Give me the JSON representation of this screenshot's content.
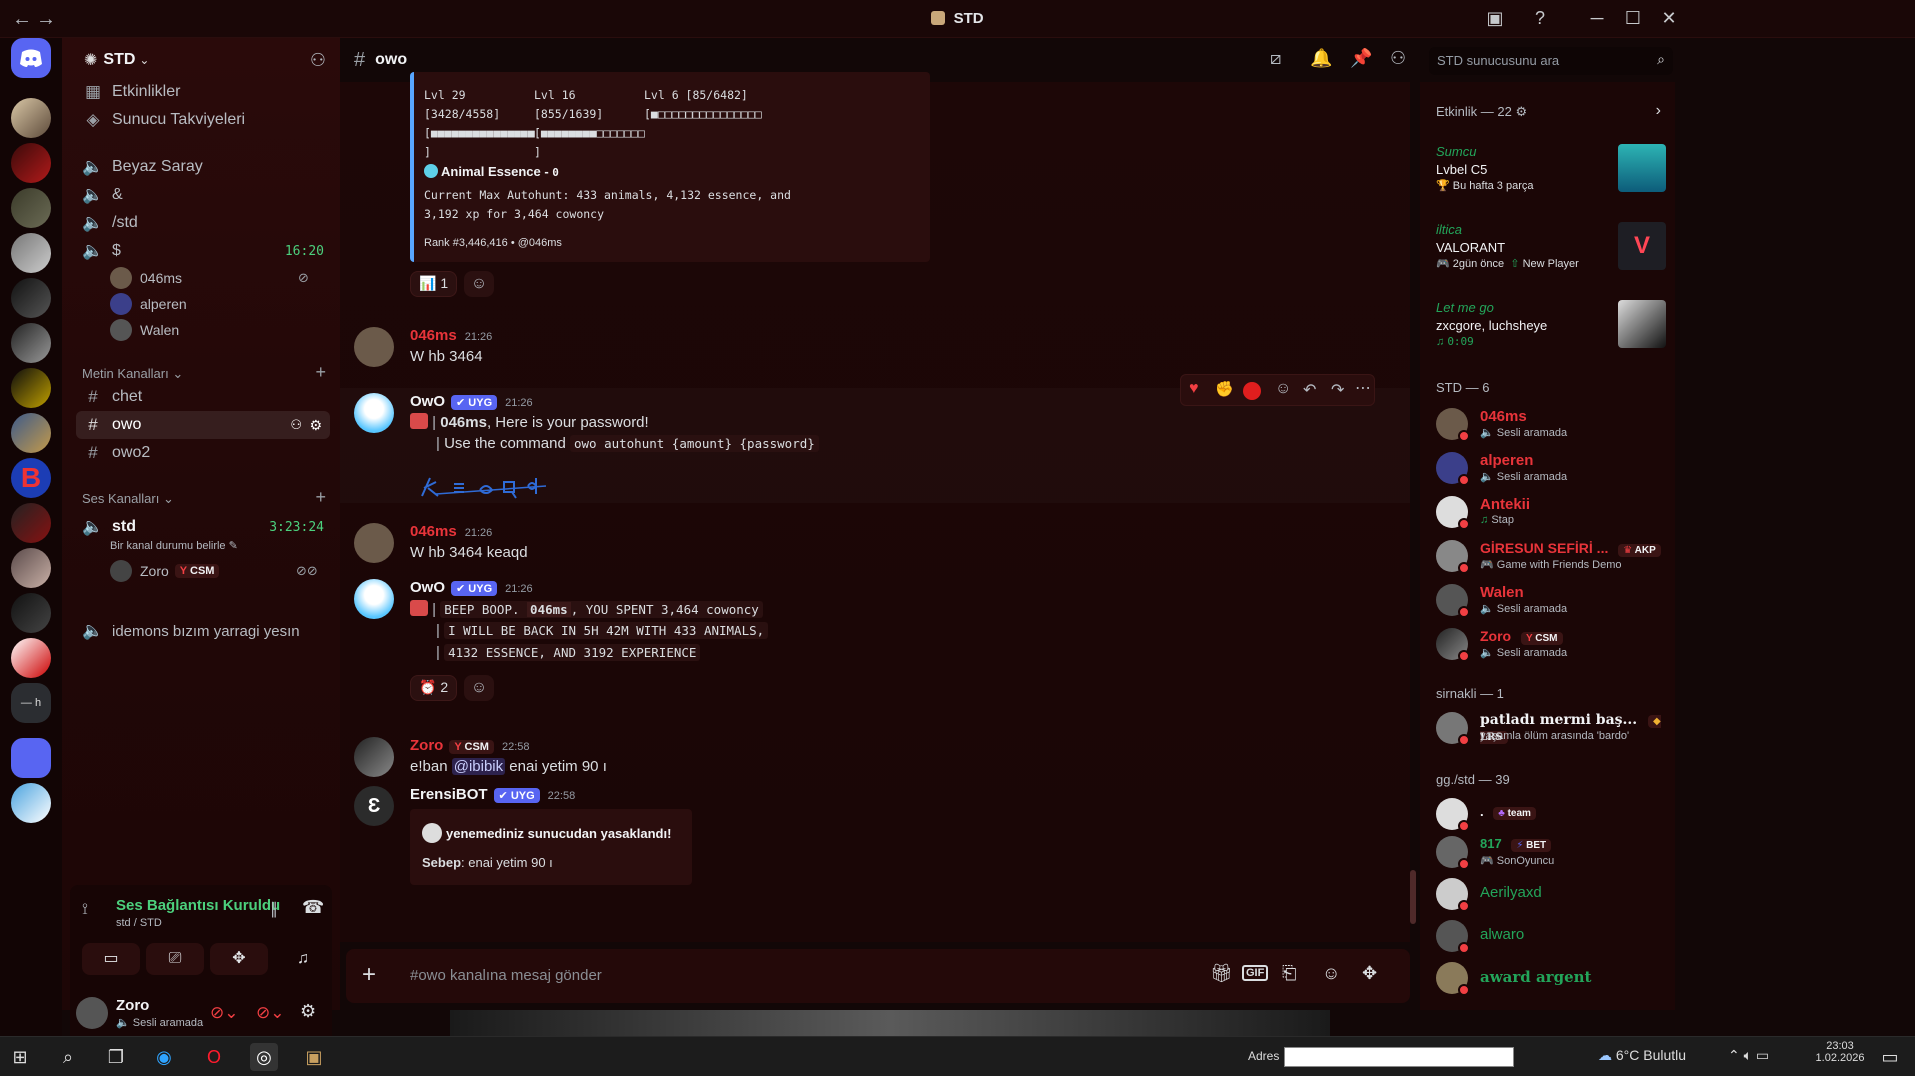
{
  "window": {
    "title": "STD"
  },
  "server": {
    "name": "STD",
    "events": "Etkinlikler",
    "boosts": "Sunucu Takviyeleri",
    "channels_top": [
      {
        "name": "Beyaz Saray"
      },
      {
        "name": "&"
      },
      {
        "name": "/std"
      },
      {
        "name": "$",
        "time": "16:20"
      }
    ],
    "voice_users_top": [
      {
        "name": "046ms"
      },
      {
        "name": "alperen"
      },
      {
        "name": "Walen"
      }
    ],
    "text_category": "Metin Kanalları",
    "text_channels": [
      {
        "name": "chet"
      },
      {
        "name": "owo"
      },
      {
        "name": "owo2"
      }
    ],
    "voice_category": "Ses Kanalları",
    "voice_channel": {
      "name": "std",
      "time": "3:23:24",
      "status": "Bir kanal durumu belirle"
    },
    "voice_channel_user": {
      "name": "Zoro",
      "tag": "CSM"
    },
    "voice_channel_2": "idemons bızım yarragi yesın"
  },
  "voice_panel": {
    "status": "Ses Bağlantısı Kuruldu",
    "sub": "std / STD",
    "user": "Zoro",
    "user_status": "Sesli aramada"
  },
  "channel": {
    "name": "owo",
    "search_placeholder": "STD sunucusunu ara",
    "composer_placeholder": "#owo kanalına mesaj gönder"
  },
  "embed_top": {
    "col1": [
      "Lvl 29",
      "[3428/4558]",
      "[■■■■■■■■■■■■■■■",
      "]"
    ],
    "col2": [
      "Lvl 16",
      "[855/1639]",
      "[■■■■■■■■□□□□□□□",
      "]"
    ],
    "col3": [
      "Lvl 6 [85/6482]",
      "[■□□□□□□□□□□□□□□□"
    ],
    "essence_title": "Animal Essence - ",
    "essence_value": "0",
    "autohunt_line1": "Current Max Autohunt: 433 animals, 4,132 essence, and",
    "autohunt_line2": "3,192 xp for 3,464 cowoncy",
    "rank": "Rank #3,446,416 • @046ms",
    "reaction_count": "1"
  },
  "messages": [
    {
      "author": "046ms",
      "time": "21:26",
      "text": "W hb 3464"
    },
    {
      "author": "OwO",
      "tag": "UYG",
      "time": "21:26",
      "mention": "046ms",
      "line1_rest": ", Here is your password!",
      "line2_prefix": "Use the command ",
      "line2_code": "owo autohunt {amount} {password}",
      "captcha": "keaqd"
    },
    {
      "author": "046ms",
      "time": "21:26",
      "text": "W hb 3464 keaqd"
    },
    {
      "author": "OwO",
      "tag": "UYG",
      "time": "21:26",
      "code1_a": "BEEP BOOP. ",
      "code1_b": "046ms",
      "code1_c": ", YOU SPENT 3,464 cowoncy",
      "code2": "I WILL BE BACK IN 5H 42M WITH 433 ANIMALS,",
      "code3": "4132 ESSENCE, AND 3192 EXPERIENCE",
      "reaction_count": "2"
    },
    {
      "author": "Zoro",
      "tag": "CSM",
      "time": "22:58",
      "prefix": "e!ban ",
      "mention": "@ibibik",
      "suffix": " enai yetim 90 ı"
    },
    {
      "author": "ErensiBOT",
      "tag": "UYG",
      "time": "22:58",
      "embed_title": "yenemediniz sunucudan yasaklandı!",
      "embed_reason_label": "Sebep",
      "embed_reason": ": enai yetim 90 ı"
    }
  ],
  "members": {
    "activity_header": "Etkinlik — 22",
    "activities": [
      {
        "user": "Sumcu",
        "title": "Lvbel C5",
        "sub": "Bu hafta 3 parça"
      },
      {
        "user": "iltica",
        "title": "VALORANT",
        "sub": "2gün önce",
        "sub2": "New Player"
      },
      {
        "user": "Let me go",
        "title": "zxcgore, luchsheye",
        "sub": "0:09"
      }
    ],
    "std_header": "STD — 6",
    "std_members": [
      {
        "name": "046ms",
        "sub": "Sesli aramada"
      },
      {
        "name": "alperen",
        "sub": "Sesli aramada"
      },
      {
        "name": "Antekii",
        "sub": "Stap"
      },
      {
        "name": "GİRESUN SEFİRİ ...",
        "tag": "AKP",
        "sub": "Game with Friends Demo"
      },
      {
        "name": "Walen",
        "sub": "Sesli aramada"
      },
      {
        "name": "Zoro",
        "tag": "CSM",
        "sub": "Sesli aramada"
      }
    ],
    "sirnakli_header": "sirnakli — 1",
    "sirnakli_members": [
      {
        "name": "patladı mermi baş...",
        "tag": "LRS",
        "sub": "yaşamla ölüm arasında 'bardo'"
      }
    ],
    "gg_header": "gg./std — 39",
    "gg_members": [
      {
        "name": ".",
        "tag": "team"
      },
      {
        "name": "817",
        "tag": "BET",
        "sub": "SonOyuncu"
      },
      {
        "name": "Aerilyaxd"
      },
      {
        "name": "alwaro"
      },
      {
        "name": "award argent"
      }
    ]
  },
  "taskbar": {
    "address_label": "Adres",
    "weather": "6°C Bulutlu",
    "time": "23:03",
    "date": "1.02.2026"
  },
  "colors": {
    "accent_red": "#f23f43",
    "name_red": "#e8343a",
    "owo_blue": "#58a6ff",
    "online_green": "#23a55a",
    "tag_blue": "#5865f2"
  }
}
